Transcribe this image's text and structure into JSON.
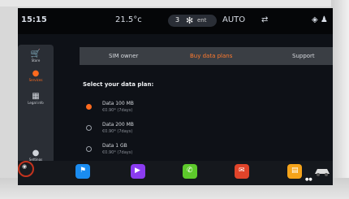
{
  "status_bar": {
    "time": "15:15",
    "temperature": "21.5°c",
    "fan_level": "3",
    "fan_mode": "ent",
    "auto_label": "AUTO",
    "icons": [
      "fan-icon",
      "recirculation-icon",
      "gps-icon",
      "account-icon"
    ]
  },
  "sidebar": {
    "items": [
      {
        "label": "Store",
        "icon": "cart-icon"
      },
      {
        "label": "Services",
        "icon": "services-icon",
        "active": true
      },
      {
        "label": "Legal info",
        "icon": "legal-info-icon"
      },
      {
        "label": "Settings",
        "icon": "settings-icon"
      }
    ]
  },
  "tabs": [
    {
      "label": "SIM owner"
    },
    {
      "label": "Buy data plans",
      "active": true
    },
    {
      "label": "Support"
    }
  ],
  "main": {
    "title": "Select your data plan:",
    "plans": [
      {
        "name": "Data 100 MB",
        "price": "€0.90* (7days)",
        "selected": true
      },
      {
        "name": "Data 200 MB",
        "price": "€0.90* (7days)",
        "selected": false
      },
      {
        "name": "Data 1 GB",
        "price": "€0.90* (7days)",
        "selected": false
      }
    ]
  },
  "dock": {
    "items": [
      {
        "name": "home",
        "icon": "home-icon"
      },
      {
        "name": "navigation",
        "icon": "navigation-icon"
      },
      {
        "name": "media",
        "icon": "media-icon"
      },
      {
        "name": "phone",
        "icon": "phone-icon"
      },
      {
        "name": "messages",
        "icon": "messages-icon"
      },
      {
        "name": "apps",
        "icon": "apps-icon"
      }
    ]
  },
  "colors": {
    "accent": "#ff6a1e",
    "background": "#0e1117",
    "tab_bar": "#3a3e44",
    "sidebar": "#2a2e35"
  }
}
